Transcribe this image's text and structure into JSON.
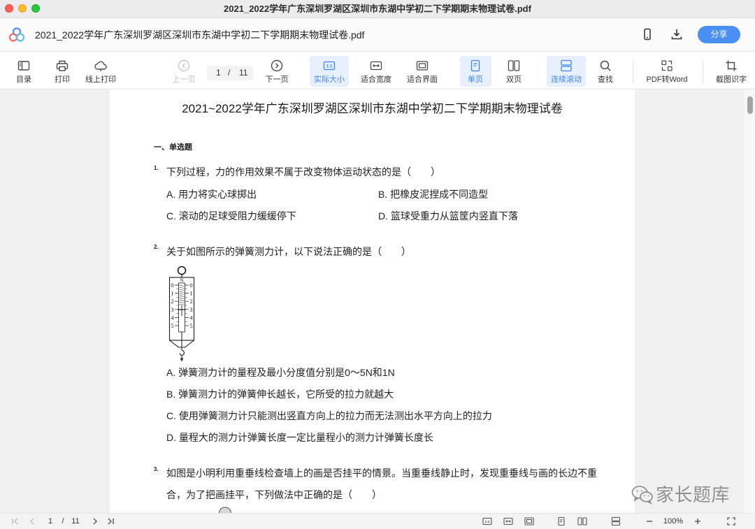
{
  "window": {
    "title": "2021_2022学年广东深圳罗湖区深圳市东湖中学初二下学期期末物理试卷.pdf"
  },
  "appbar": {
    "filename": "2021_2022学年广东深圳罗湖区深圳市东湖中学初二下学期期末物理试卷.pdf",
    "share_label": "分享",
    "icons": [
      "app-logo",
      "phone-icon",
      "download-icon"
    ]
  },
  "toolbar": {
    "toc": "目录",
    "print": "打印",
    "online_print": "线上打印",
    "prev_page": "上一页",
    "current_page": "1",
    "page_sep": "/",
    "total_pages": "11",
    "next_page": "下一页",
    "actual_size": "实际大小",
    "actual_size_glyph": "1:1",
    "fit_width": "适合宽度",
    "fit_page": "适合界面",
    "single_page": "单页",
    "double_page": "双页",
    "continuous_scroll": "连续滚动",
    "find": "查找",
    "pdf_to_word": "PDF转Word",
    "screenshot_ocr": "截图识字"
  },
  "document": {
    "title": "2021~2022学年广东深圳罗湖区深圳市东湖中学初二下学期期末物理试卷",
    "section": "一、单选题",
    "questions": [
      {
        "number": "1.",
        "lines": [
          "下列过程，力的作用效果不属于改变物体运动状态的是（　　）"
        ],
        "options": [
          "A. 用力将实心球掷出",
          "B. 把橡皮泥捏成不同造型",
          "C. 滚动的足球受阻力缓缓停下",
          "D. 篮球受重力从篮筐内竖直下落"
        ]
      },
      {
        "number": "2.",
        "lines": [
          "关于如图所示的弹簧测力计，以下说法正确的是（　　）"
        ],
        "figure": {
          "unit": "N",
          "ticks": [
            "0",
            "1",
            "2",
            "3",
            "4",
            "5"
          ]
        },
        "options": [
          "A. 弹簧测力计的量程及最小分度值分别是0～5N和1N",
          "B. 弹簧测力计的弹簧伸长越长，它所受的拉力就越大",
          "C. 使用弹簧测力计只能测出竖直方向上的拉力而无法测出水平方向上的拉力",
          "D. 量程大的测力计弹簧长度一定比量程小的测力计弹簧长度长"
        ]
      },
      {
        "number": "3.",
        "lines": [
          "如图是小明利用重垂线检查墙上的画是否挂平的情景。当重垂线静止时，发现重垂线与画的长边不重",
          "合，为了把画挂平，下列做法中正确的是（　　）"
        ]
      }
    ]
  },
  "watermark": {
    "text": "家长题库",
    "icon": "wechat-icon"
  },
  "statusbar": {
    "current_page": "1",
    "page_sep": "/",
    "total_pages": "11",
    "actual_size_glyph": "1:1",
    "zoom": "100%"
  },
  "colors": {
    "accent": "#4a8ff5",
    "active_bg": "#e8f0fd",
    "active_fg": "#3f86f0",
    "viewer_bg": "#f0f0f0",
    "titlebar_bg": "#ececec"
  }
}
